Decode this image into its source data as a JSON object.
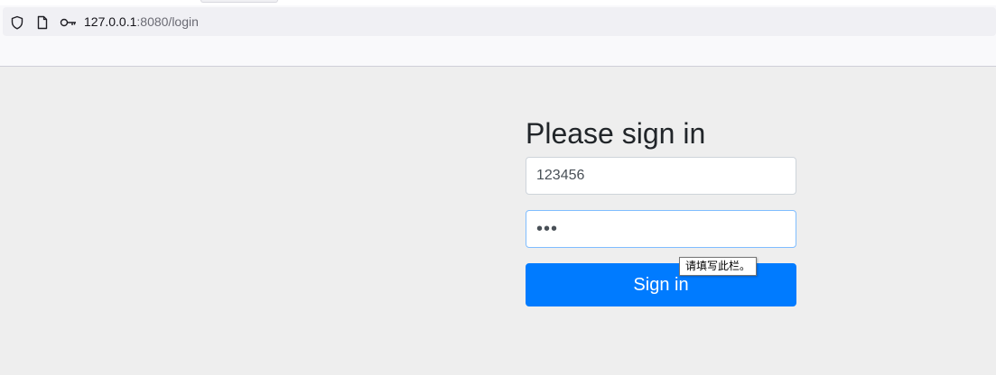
{
  "browser": {
    "url_host": "127.0.0.1",
    "url_rest": ":8080/login",
    "icons": {
      "security": "shield-icon",
      "page": "page-icon",
      "permissions": "key-icon"
    }
  },
  "login_form": {
    "heading": "Please sign in",
    "username_value": "123456",
    "password_value": "abc",
    "submit_label": "Sign in",
    "validation_tooltip": "请填写此栏。"
  },
  "colors": {
    "page_background": "#eeeeee",
    "primary_button": "#007bff",
    "focus_border": "#80bdff"
  }
}
